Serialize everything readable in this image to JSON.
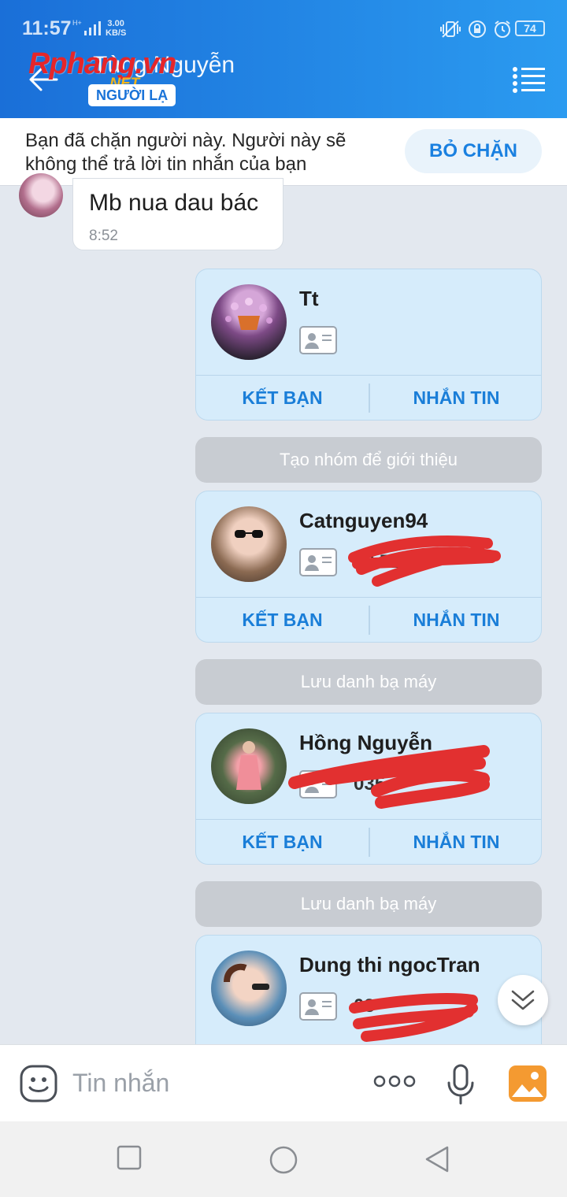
{
  "status_bar": {
    "time": "11:57",
    "network": "H+",
    "speed": "3.00",
    "speed_unit": "KB/S",
    "battery": "74"
  },
  "header": {
    "watermark_logo": "Rphang.vn",
    "watermark_net": ".NET",
    "contact_name": "Tùng Nguyễn",
    "stranger_badge": "NGƯỜI LẠ",
    "accent_color": "#1a6fd8"
  },
  "blocked_banner": {
    "message": "Bạn đã chặn người này. Người này sẽ không thể trả lời tin nhắn của bạn",
    "unblock_label": "BỎ CHẶN"
  },
  "messages": [
    {
      "type": "incoming",
      "text": "Mb nua dau bác",
      "time": "8:52"
    }
  ],
  "cards": [
    {
      "name": "Tt",
      "phone": "",
      "add_friend": "KẾT BẠN",
      "message": "NHẮN TIN"
    },
    {
      "name": "Catnguyen94",
      "phone": "09 719",
      "add_friend": "KẾT BẠN",
      "message": "NHẮN TIN"
    },
    {
      "name": "Hồng Nguyễn",
      "phone": "035",
      "add_friend": "KẾT BẠN",
      "message": "NHẮN TIN"
    },
    {
      "name": "Dung thi ngocTran",
      "phone": "03",
      "add_friend": "KẾT BẠN",
      "message": "NHẮN TIN"
    }
  ],
  "system_notes": [
    "Tạo nhóm để giới thiệu",
    "Lưu danh bạ máy",
    "Lưu danh bạ máy"
  ],
  "input": {
    "placeholder": "Tin nhắn"
  }
}
